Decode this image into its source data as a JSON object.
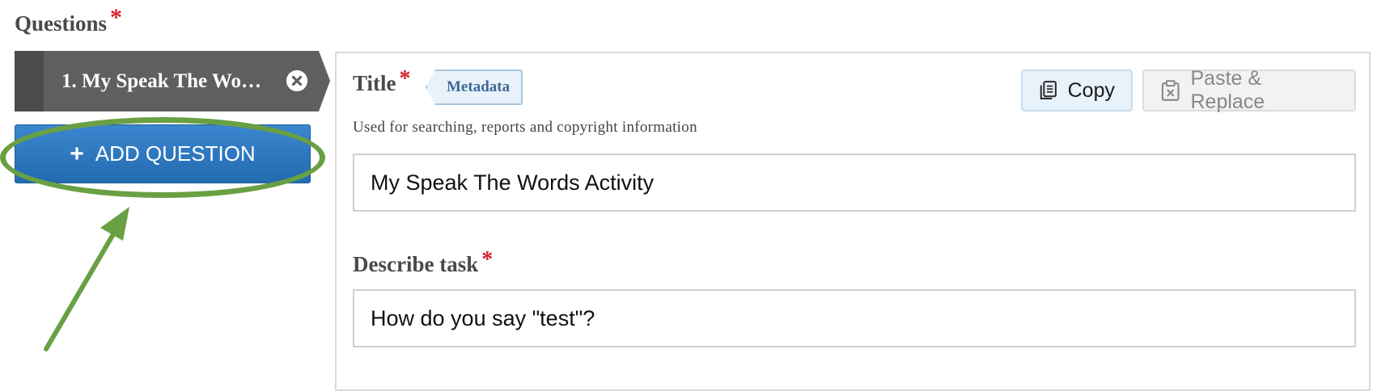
{
  "section": {
    "title": "Questions",
    "required_mark": "*"
  },
  "question_tab": {
    "label": "1. My Speak The Wo…",
    "remove_icon": "close-circle-icon"
  },
  "add_button": {
    "icon": "+",
    "label": "ADD QUESTION"
  },
  "annotation": {
    "color": "#69a043",
    "shapes": [
      "ellipse",
      "arrow"
    ]
  },
  "form": {
    "title_field": {
      "label": "Title",
      "required_mark": "*",
      "tag": "Metadata",
      "description": "Used for searching, reports and copyright information",
      "value": "My Speak The Words Activity"
    },
    "task_field": {
      "label": "Describe task",
      "required_mark": "*",
      "value": "How do you say \"test\"?"
    },
    "toolbar": {
      "copy_label": "Copy",
      "copy_icon": "copy-icon",
      "paste_label": "Paste & Replace",
      "paste_icon": "clipboard-icon"
    }
  },
  "colors": {
    "accent_blue": "#236bb0",
    "required_red": "#d4202b",
    "annotation_green": "#69a043",
    "tab_gray": "#5f5f5f"
  }
}
